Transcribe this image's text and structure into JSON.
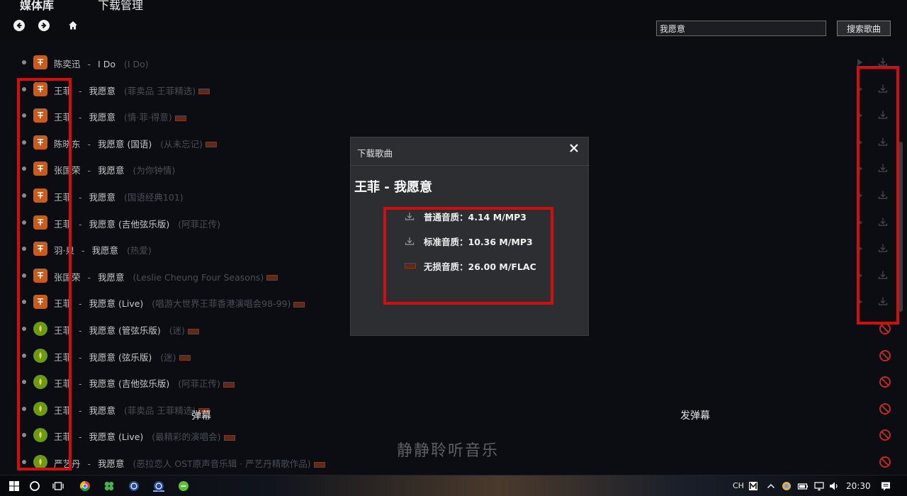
{
  "header": {
    "tab_media": "媒体库",
    "tab_download": "下载管理",
    "search_value": "我愿意",
    "search_button": "搜索歌曲"
  },
  "songs": [
    {
      "artist": "陈奕迅",
      "title": "I Do",
      "album": "(I Do)",
      "source": "xiami",
      "sq": false,
      "action": "download"
    },
    {
      "artist": "王菲",
      "title": "我愿意",
      "album": "(菲卖品 王菲精选)",
      "source": "xiami",
      "sq": true,
      "action": "download"
    },
    {
      "artist": "王菲",
      "title": "我愿意",
      "album": "(情·菲·得意)",
      "source": "xiami",
      "sq": true,
      "action": "download"
    },
    {
      "artist": "陈晓东",
      "title": "我愿意 (国语)",
      "album": "(从未忘记)",
      "source": "xiami",
      "sq": true,
      "action": "download"
    },
    {
      "artist": "张国荣",
      "title": "我愿意",
      "album": "(为你钟情)",
      "source": "xiami",
      "sq": false,
      "action": "download"
    },
    {
      "artist": "王菲",
      "title": "我愿意",
      "album": "(国语经典101)",
      "source": "xiami",
      "sq": false,
      "action": "download"
    },
    {
      "artist": "王菲",
      "title": "我愿意 (吉他弦乐版)",
      "album": "(阿菲正传)",
      "source": "xiami",
      "sq": false,
      "action": "download"
    },
    {
      "artist": "羽·泉",
      "title": "我愿意",
      "album": "(热爱)",
      "source": "xiami",
      "sq": false,
      "action": "download"
    },
    {
      "artist": "张国荣",
      "title": "我愿意",
      "album": "(Leslie Cheung Four Seasons)",
      "source": "xiami",
      "sq": true,
      "action": "download"
    },
    {
      "artist": "王菲",
      "title": "我愿意 (Live)",
      "album": "(唱游大世界王菲香港演唱会98-99)",
      "source": "xiami",
      "sq": true,
      "action": "download"
    },
    {
      "artist": "王菲",
      "title": "我愿意 (管弦乐版)",
      "album": "(迷)",
      "source": "green",
      "sq": true,
      "action": "blocked"
    },
    {
      "artist": "王菲",
      "title": "我愿意 (弦乐版)",
      "album": "(迷)",
      "source": "green",
      "sq": true,
      "action": "blocked"
    },
    {
      "artist": "王菲",
      "title": "我愿意 (吉他弦乐版)",
      "album": "(阿菲正传)",
      "source": "green",
      "sq": true,
      "action": "blocked"
    },
    {
      "artist": "王菲",
      "title": "我愿意",
      "album": "(菲卖品 王菲精选)",
      "source": "green",
      "sq": true,
      "action": "blocked"
    },
    {
      "artist": "王菲",
      "title": "我愿意 (Live)",
      "album": "(最精彩的演唱会)",
      "source": "green",
      "sq": true,
      "action": "blocked"
    },
    {
      "artist": "严艺丹",
      "title": "我愿意",
      "album": "(恶拉恋人 OST原声音乐辑 · 严艺丹精歌作品)",
      "source": "green",
      "sq": true,
      "action": "blocked"
    }
  ],
  "overlay": {
    "danmaku": "弹幕",
    "send_danmaku": "发弹幕",
    "slogan": "静静聆听音乐"
  },
  "dialog": {
    "title": "下载歌曲",
    "song": "王菲 - 我愿意",
    "options": [
      {
        "label": "普通音质：4.14 M/MP3",
        "icon": "download-icon"
      },
      {
        "label": "标准音质：10.36 M/MP3",
        "icon": "download-icon"
      },
      {
        "label": "无损音质：26.00 M/FLAC",
        "icon": "sq-badge"
      }
    ]
  },
  "taskbar": {
    "ime": "CH",
    "clock": "20:30"
  },
  "colors": {
    "background": "#0b0d12",
    "dialog": "#2d2e32",
    "annotation_red": "#d01010",
    "xiami_orange": "#c65d1f",
    "blocked_red": "#c0282a"
  }
}
